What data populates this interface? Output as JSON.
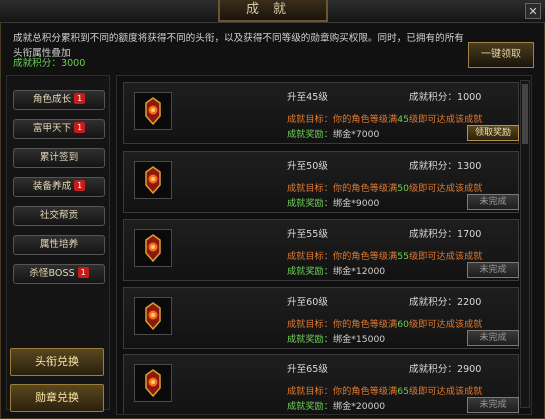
{
  "window": {
    "title": "成就",
    "close_label": "✕"
  },
  "header": {
    "description": "成就总积分累积到不同的额度将获得不同的头衔，以及获得不同等级的勋章购买权限。同时，已拥有的所有头衔属性叠加",
    "score_total": "成就积分：3000",
    "onekey_label": "一键领取"
  },
  "sidebar": {
    "items": [
      {
        "label": "角色成长",
        "badge": "1"
      },
      {
        "label": "富甲天下",
        "badge": "1"
      },
      {
        "label": "累计签到",
        "badge": ""
      },
      {
        "label": "装备养成",
        "badge": "1"
      },
      {
        "label": "社交帮贡",
        "badge": ""
      },
      {
        "label": "属性培养",
        "badge": ""
      },
      {
        "label": "杀怪BOSS",
        "badge": "1"
      }
    ],
    "title_exchange": "头衔兑换",
    "medal_exchange": "勋章兑换"
  },
  "achievements": [
    {
      "title": "升至45级",
      "score": "成就积分：1000",
      "goal_prefix": "成就目标：你的角色等级满",
      "goal_level": "45",
      "goal_suffix": "级即可达成该成就",
      "reward_prefix": "成就奖励：",
      "reward_value": "绑金*7000",
      "status": "领取奖励"
    },
    {
      "title": "升至50级",
      "score": "成就积分：1300",
      "goal_prefix": "成就目标：你的角色等级满",
      "goal_level": "50",
      "goal_suffix": "级即可达成该成就",
      "reward_prefix": "成就奖励：",
      "reward_value": "绑金*9000",
      "status": "未完成"
    },
    {
      "title": "升至55级",
      "score": "成就积分：1700",
      "goal_prefix": "成就目标：你的角色等级满",
      "goal_level": "55",
      "goal_suffix": "级即可达成该成就",
      "reward_prefix": "成就奖励：",
      "reward_value": "绑金*12000",
      "status": "未完成"
    },
    {
      "title": "升至60级",
      "score": "成就积分：2200",
      "goal_prefix": "成就目标：你的角色等级满",
      "goal_level": "60",
      "goal_suffix": "级即可达成该成就",
      "reward_prefix": "成就奖励：",
      "reward_value": "绑金*15000",
      "status": "未完成"
    },
    {
      "title": "升至65级",
      "score": "成就积分：2900",
      "goal_prefix": "成就目标：你的角色等级满",
      "goal_level": "65",
      "goal_suffix": "级即可达成该成就",
      "reward_prefix": "成就奖励：",
      "reward_value": "绑金*20000",
      "status": "未完成"
    }
  ],
  "colors": {
    "accent_gold": "#a08346",
    "goal_orange": "#e07a2f",
    "reward_green": "#6fd05a",
    "badge_red": "#c81b1b"
  }
}
